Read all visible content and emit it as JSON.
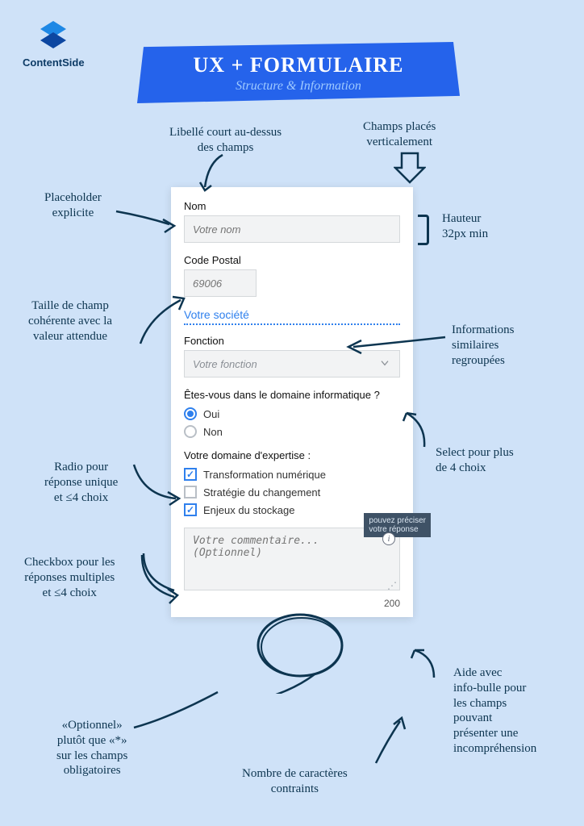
{
  "brand": {
    "name": "ContentSide"
  },
  "banner": {
    "title": "UX + FORMULAIRE",
    "subtitle": "Structure & Information"
  },
  "form": {
    "name_label": "Nom",
    "name_placeholder": "Votre nom",
    "postal_label": "Code Postal",
    "postal_placeholder": "69006",
    "company_section": "Votre société",
    "role_label": "Fonction",
    "role_placeholder": "Votre fonction",
    "it_question": "Êtes-vous dans le domaine informatique ?",
    "it_options": {
      "yes": "Oui",
      "no": "Non"
    },
    "expertise_label": "Votre domaine d'expertise :",
    "expertise_options": {
      "opt1": "Transformation numérique",
      "opt2": "Stratégie du changement",
      "opt3": "Enjeux du stockage"
    },
    "comment_placeholder": "Votre commentaire... (Optionnel)",
    "tooltip_text": "pouvez préciser\nvotre réponse",
    "char_limit": "200"
  },
  "annotations": {
    "short_label": "Libellé court au-dessus\ndes champs",
    "vertical_fields": "Champs placés\nverticalement",
    "explicit_placeholder": "Placeholder\nexplicite",
    "min_height": "Hauteur\n32px min",
    "coherent_size": "Taille de champ\ncohérente avec la\nvaleur attendue",
    "grouped_info": "Informations\nsimilaires\nregroupées",
    "select_many": "Select pour plus\nde 4 choix",
    "radio_single": "Radio pour\nréponse unique\net ≤4 choix",
    "checkbox_multi": "Checkbox pour les\nréponses multiples\net ≤4 choix",
    "optional_label": "«Optionnel»\nplutôt que «*»\nsur les champs\nobligatoires",
    "char_constraint": "Nombre de caractères\ncontraints",
    "tooltip_help": "Aide avec\ninfo-bulle pour\nles champs\npouvant\nprésenter une\nincompréhension"
  }
}
